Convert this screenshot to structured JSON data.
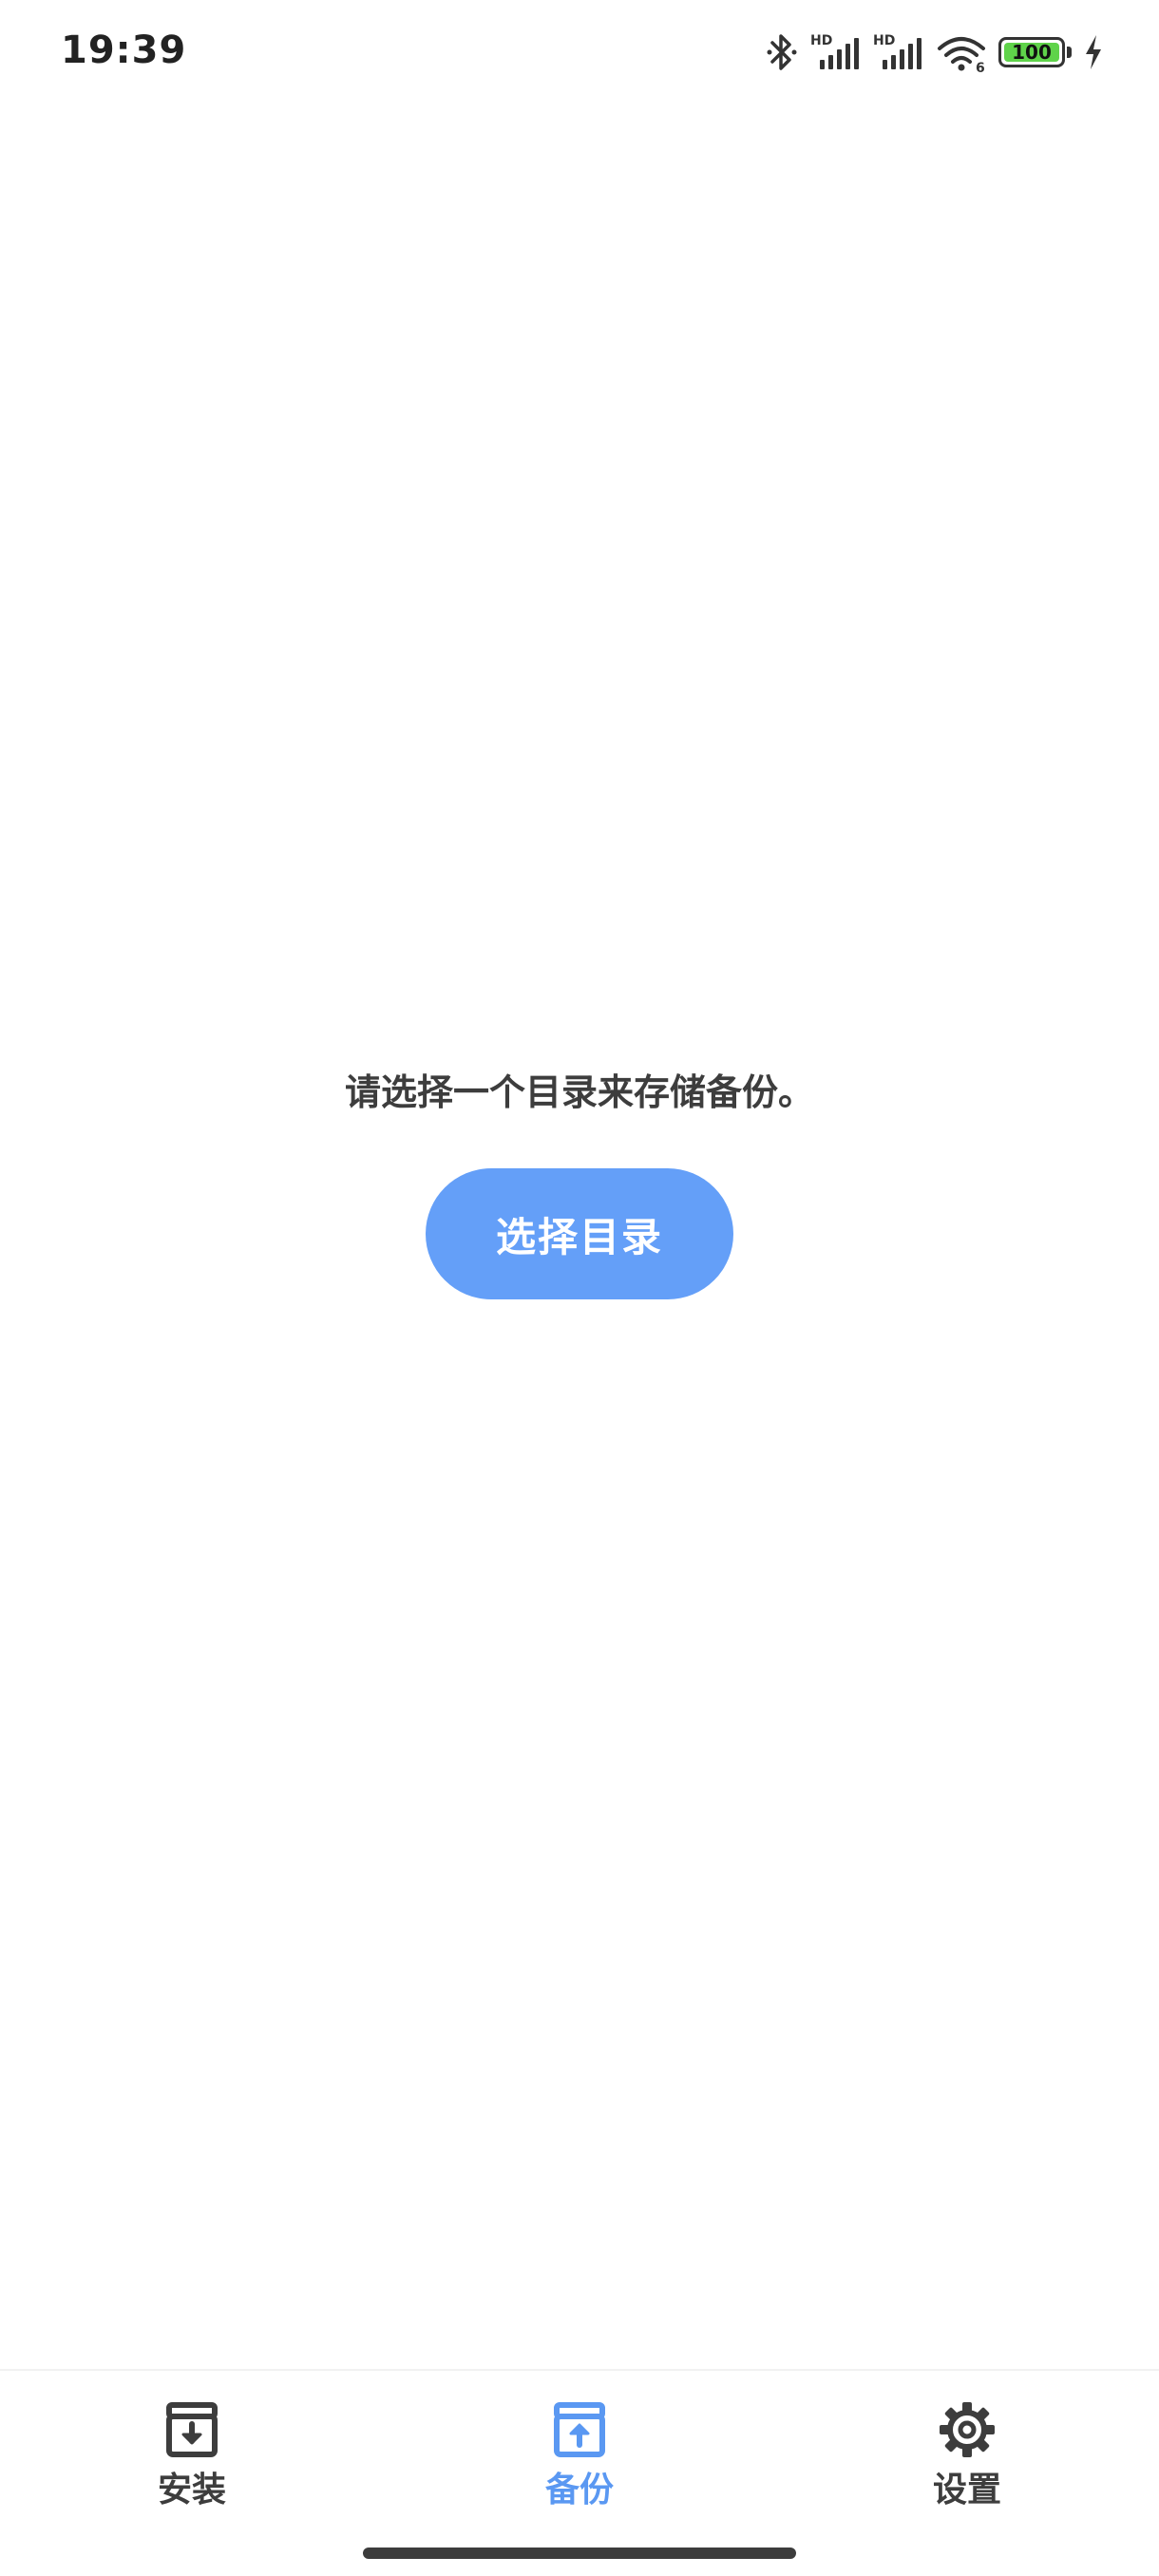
{
  "status_bar": {
    "time": "19:39",
    "icons": [
      "bluetooth-icon",
      "signal-hd-icon",
      "signal-hd-icon",
      "wifi-6-icon",
      "battery-icon",
      "charging-bolt-icon"
    ],
    "signal_tag": "HD",
    "wifi_tag": "6",
    "battery_level_percent": 100,
    "battery_text": "100",
    "battery_color": "#5fd34a"
  },
  "main": {
    "message": "请选择一个目录来存储备份。",
    "button_label": "选择目录",
    "button_color": "#649ff8"
  },
  "bottom_nav": {
    "active_color": "#5a98f2",
    "items": [
      {
        "label": "安装",
        "icon": "archive-download-icon",
        "active": false
      },
      {
        "label": "备份",
        "icon": "archive-upload-icon",
        "active": true
      },
      {
        "label": "设置",
        "icon": "gear-icon",
        "active": false
      }
    ]
  }
}
